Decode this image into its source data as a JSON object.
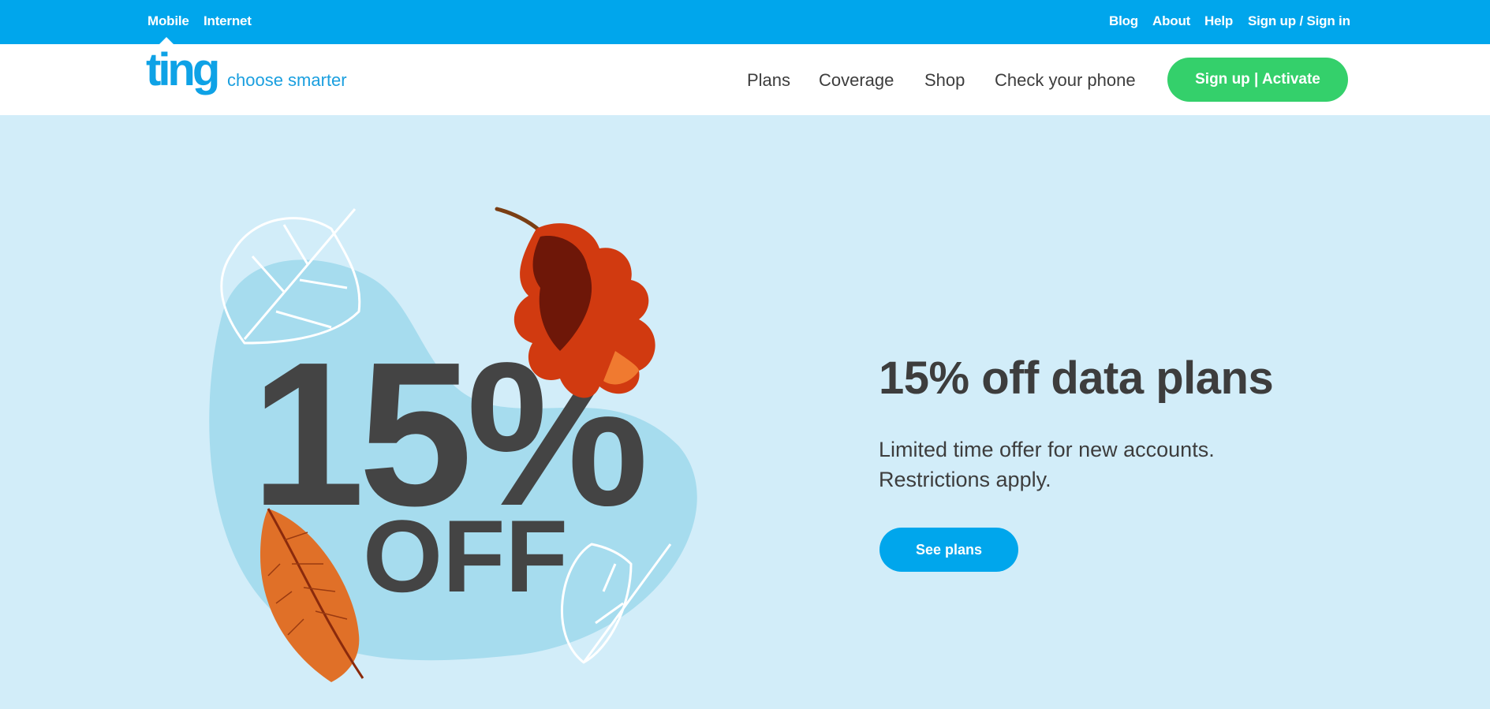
{
  "topbar": {
    "left_links": [
      "Mobile",
      "Internet"
    ],
    "right_links": [
      "Blog",
      "About",
      "Help",
      "Sign up / Sign in"
    ]
  },
  "header": {
    "logo": "ting",
    "tagline": "choose smarter",
    "nav": [
      "Plans",
      "Coverage",
      "Shop",
      "Check your phone"
    ],
    "cta": "Sign up | Activate"
  },
  "hero": {
    "badge_percent": "15%",
    "badge_off": "OFF",
    "title": "15% off data plans",
    "subtitle_lines": [
      "Limited time offer for new accounts.",
      "Restrictions apply."
    ],
    "button": "See plans"
  },
  "colors": {
    "brand_blue": "#00a6ec",
    "cta_green": "#34d06b",
    "hero_bg": "#d2edf9",
    "blob": "#a6dcee",
    "text_dark": "#3d3d3d"
  },
  "icons": [
    "leaf-outline-icon",
    "oak-leaf-icon",
    "autumn-leaf-icon"
  ]
}
